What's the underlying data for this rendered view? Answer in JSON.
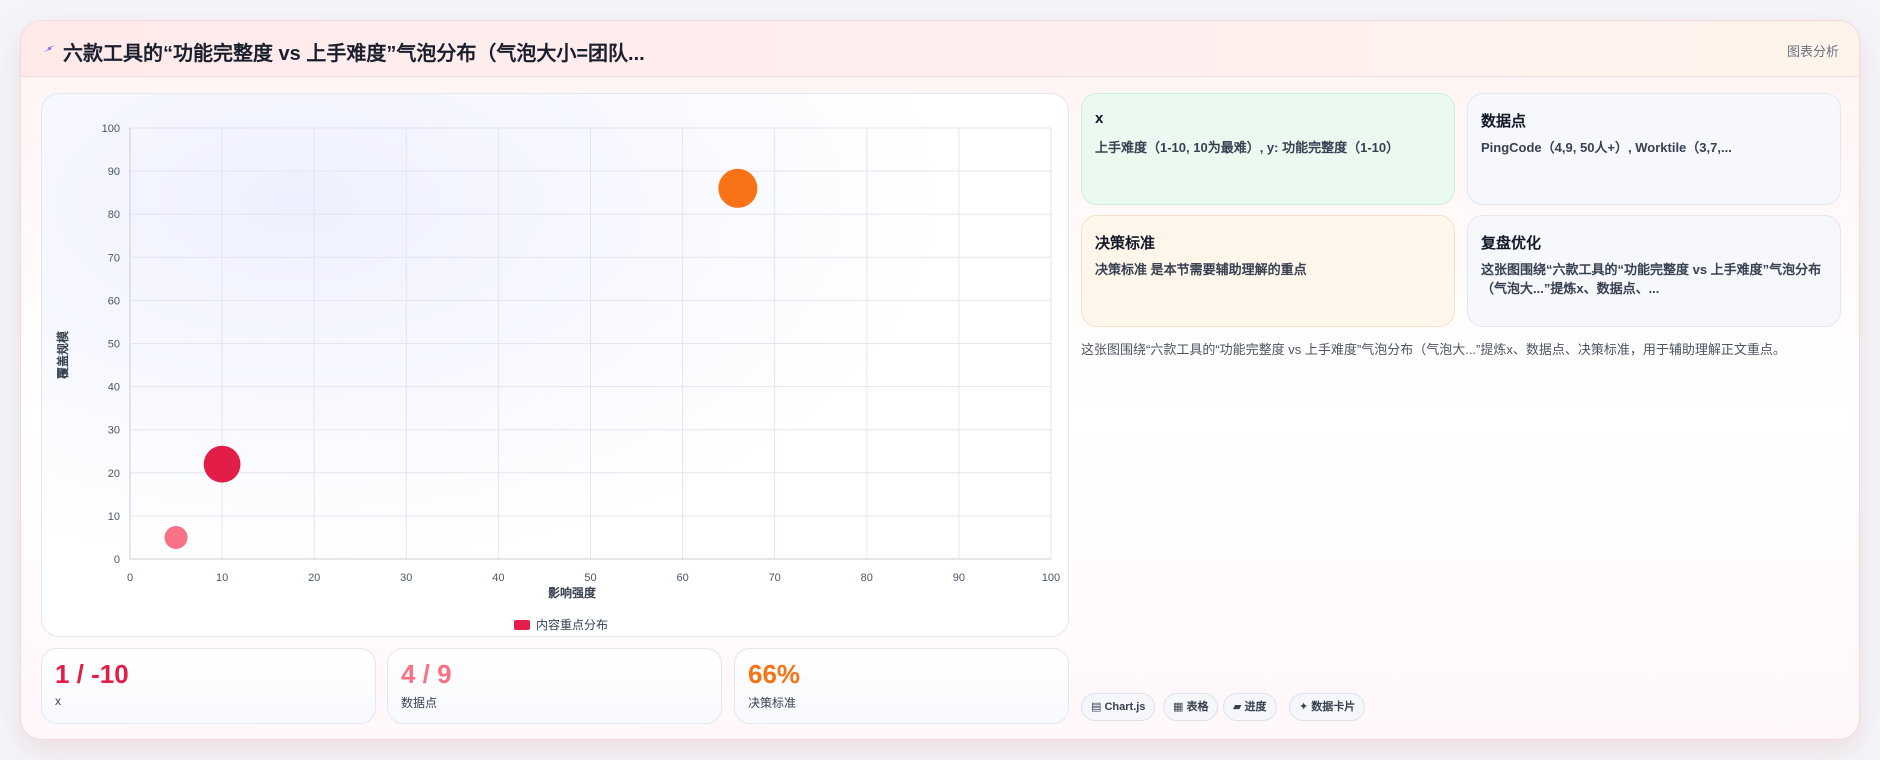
{
  "header": {
    "title": "六款工具的“功能完整度 vs 上手难度”气泡分布（气泡大小=团队...",
    "tag": "图表分析"
  },
  "chart_data": {
    "type": "scatter",
    "xlabel": "影响强度",
    "ylabel": "覆盖规模",
    "xlim": [
      0,
      100
    ],
    "ylim": [
      0,
      100
    ],
    "xticks": [
      "0",
      "10",
      "20",
      "30",
      "40",
      "50",
      "60",
      "70",
      "80",
      "90",
      "100"
    ],
    "yticks": [
      "0",
      "10",
      "20",
      "30",
      "40",
      "50",
      "60",
      "70",
      "80",
      "90",
      "100"
    ],
    "grid": true,
    "legend_position": "bottom",
    "series": [
      {
        "name": "内容重点分布",
        "points": [
          {
            "x": 5,
            "y": 5,
            "r": 10,
            "color": "#f87185"
          },
          {
            "x": 10,
            "y": 22,
            "r": 16,
            "color": "#e11d48"
          },
          {
            "x": 66,
            "y": 86,
            "r": 17,
            "color": "#f97316"
          }
        ],
        "legend_color": "#e11d48"
      }
    ]
  },
  "stats": [
    {
      "value": "1 / -10",
      "label": "x",
      "color": "#e11d48"
    },
    {
      "value": "4 / 9",
      "label": "数据点",
      "color": "#f87185"
    },
    {
      "value": "66%",
      "label": "决策标准",
      "color": "#f97316"
    }
  ],
  "info_cards": [
    {
      "title": "x",
      "text": "上手难度（1-10, 10为最难）, y: 功能完整度（1-10）",
      "bg": "#eafaf1",
      "border": "#cfeedd"
    },
    {
      "title": "数据点",
      "text": "PingCode（4,9, 50人+）, Worktile（3,7,...",
      "bg": "#f7f8fc",
      "border": "#e3e7ef"
    },
    {
      "title": "决策标准",
      "text": "决策标准 是本节需要辅助理解的重点",
      "bg": "#fff6eb",
      "border": "#f4e2c8"
    },
    {
      "title": "复盘优化",
      "text": "这张图围绕“六款工具的“功能完整度 vs 上手难度”气泡分布（气泡大...”提炼x、数据点、...",
      "bg": "#f7f8fc",
      "border": "#e3e7ef"
    }
  ],
  "summary": "这张图围绕“六款工具的“功能完整度 vs 上手难度”气泡分布（气泡大...”提炼x、数据点、决策标准，用于辅助理解正文重点。",
  "chips": [
    {
      "icon": "▤",
      "label": "Chart.js"
    },
    {
      "icon": "▦",
      "label": "表格"
    },
    {
      "icon": "▰",
      "label": "进度"
    },
    {
      "icon": "✦",
      "label": "数据卡片"
    }
  ]
}
